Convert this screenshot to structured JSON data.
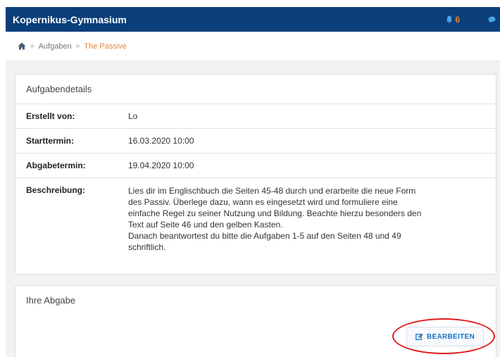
{
  "header": {
    "brand": "Kopernikus-Gymnasium",
    "notification_count": "6",
    "icons": [
      "bell-icon",
      "chat-icon"
    ],
    "brand_color": "#0b3f7a",
    "accent_color": "#f0822a"
  },
  "breadcrumb": {
    "home_icon": "home-icon",
    "separator": "»",
    "items": [
      "Aufgaben",
      "The Passive"
    ]
  },
  "details": {
    "title": "Aufgabendetails",
    "rows": [
      {
        "label": "Erstellt von:",
        "value": "Lo"
      },
      {
        "label": "Starttermin:",
        "value": "16.03.2020 10:00"
      },
      {
        "label": "Abgabetermin:",
        "value": "19.04.2020 10:00"
      }
    ],
    "description": {
      "label": "Beschreibung:",
      "lines": [
        "Lies dir im Englischbuch die Seiten 45-48 durch und erarbeite die neue Form",
        "des Passiv. Überlege dazu, wann es eingesetzt wird und formuliere eine",
        "einfache Regel zu seiner Nutzung und Bildung. Beachte hierzu besonders den",
        "Text auf Seite 46 und den gelben Kasten.",
        "Danach beantwortest du bitte die Aufgaben 1-5 auf den Seiten 48 und 49",
        "schriftlich."
      ]
    }
  },
  "submission": {
    "title": "Ihre Abgabe",
    "edit_button_label": "BEARBEITEN",
    "edit_icon": "edit-icon",
    "highlight_color": "#e01b1b"
  }
}
